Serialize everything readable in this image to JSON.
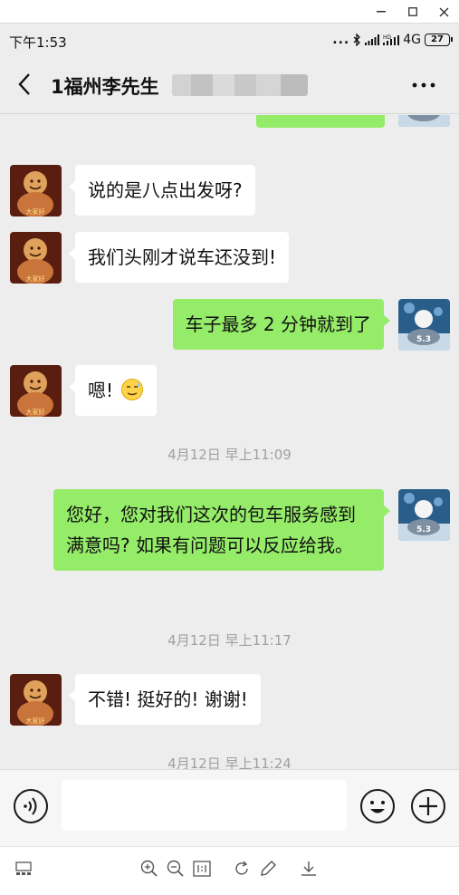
{
  "status": {
    "time": "下午1:53",
    "dots": "...",
    "network": "4G",
    "hd_label": "HD",
    "battery": "27"
  },
  "header": {
    "title": "1福州李先生",
    "back_icon": "chevron-left-icon",
    "more_icon": "more-horizontal-icon"
  },
  "messages": [
    {
      "side": "left",
      "text": "说的是八点出发呀?"
    },
    {
      "side": "left",
      "text": "我们头刚才说车还没到!"
    },
    {
      "side": "right",
      "text": "车子最多 2 分钟就到了"
    },
    {
      "side": "left",
      "text": "嗯!",
      "emoji": "sweat-smile-emoji"
    },
    {
      "type": "time",
      "text": "4月12日 早上11:09"
    },
    {
      "side": "right",
      "text": "您好，您对我们这次的包车服务感到满意吗? 如果有问题可以反应给我。"
    },
    {
      "type": "time",
      "text": "4月12日 早上11:17"
    },
    {
      "side": "left",
      "text": "不错! 挺好的! 谢谢!"
    },
    {
      "type": "time",
      "text": "4月12日 早上11:24"
    }
  ],
  "avatars": {
    "left_caption": "大家好",
    "right_caption": "5.3"
  },
  "input_bar": {
    "voice_icon": "voice-icon",
    "emoji_icon": "emoji-icon",
    "plus_icon": "plus-circle-icon",
    "placeholder": ""
  },
  "colors": {
    "chat_bg": "#ededed",
    "bubble_green": "#95ec69",
    "bubble_white": "#ffffff",
    "timestamp": "#a0a0a0"
  }
}
